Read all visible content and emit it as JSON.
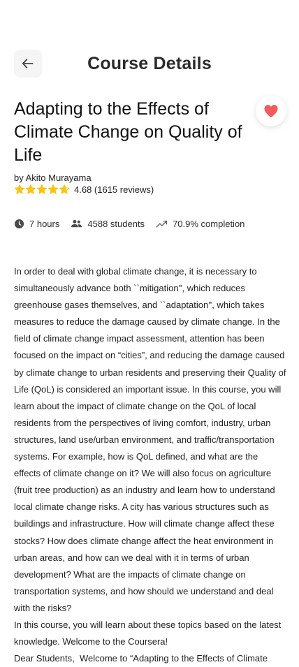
{
  "header": {
    "title": "Course Details",
    "back_icon": "arrow-left-icon"
  },
  "course": {
    "title": "Adapting to the Effects of Climate Change on Quality of Life",
    "author": "by Akito Murayama",
    "favorite_icon": "heart-icon",
    "favorited": true,
    "rating": {
      "value": 4.68,
      "stars_max": 5,
      "text": "4.68 (1615 reviews)"
    },
    "stats": [
      {
        "icon": "clock-icon",
        "label": "7 hours"
      },
      {
        "icon": "students-icon",
        "label": "4588 students"
      },
      {
        "icon": "trending-up-icon",
        "label": "70.9% completion"
      }
    ],
    "description": [
      "In order to deal with global climate change, it is necessary to simultaneously advance both ``mitigation'', which reduces greenhouse gases themselves, and ``adaptation'', which takes measures to reduce the damage caused by climate change. In the field of climate change impact assessment, attention has been focused on the impact on “cities”, and reducing the damage caused by climate change to urban residents and preserving their Quality of Life (QoL) is considered an important issue. In this course, you will learn about the impact of climate change on the QoL of local residents from the perspectives of living comfort, industry, urban structures, land use/urban environment, and traffic/transportation systems. For example, how is QoL defined, and what are the effects of climate change on it? We will also focus on agriculture (fruit tree production) as an industry and learn how to understand local climate change risks. A city has various structures such as buildings and infrastructure. How will climate change affect these stocks? How does climate change affect the heat environment in urban areas, and how can we deal with it in terms of urban development? What are the impacts of climate change on transportation systems, and how should we understand and deal with the risks?",
      "In this course, you will learn about these topics based on the latest knowledge. Welcome to the Coursera!",
      "Dear Students,  Welcome to “Adapting to the Effects of Climate"
    ]
  },
  "colors": {
    "star": "#f5c518",
    "heart": "#f25c5c",
    "back_button_bg": "#f5f5f6",
    "text": "#1f1f1f"
  }
}
